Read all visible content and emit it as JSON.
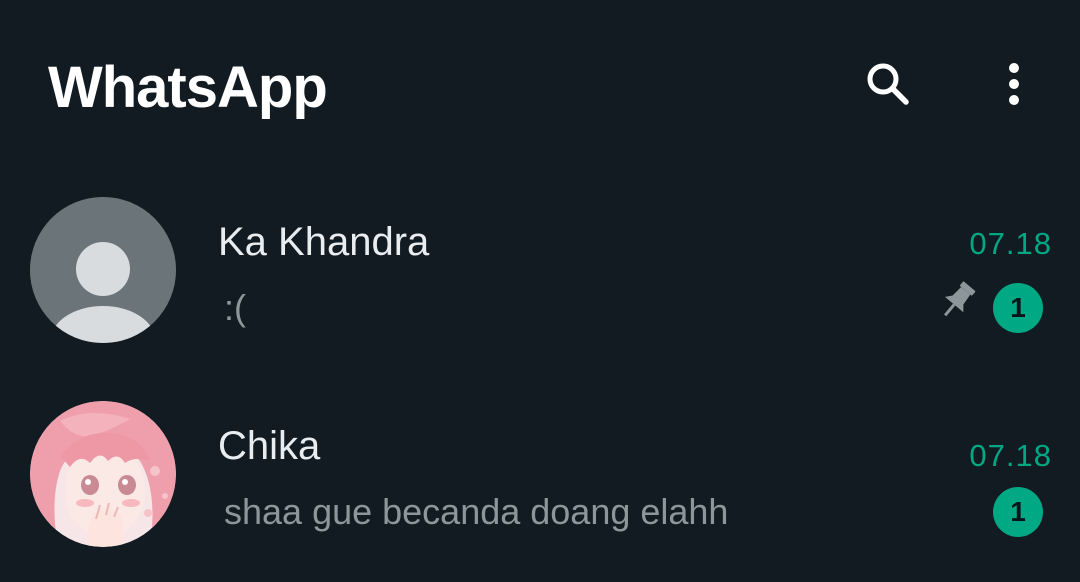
{
  "header": {
    "title": "WhatsApp",
    "search_icon": "search-icon",
    "menu_icon": "more-vertical-icon"
  },
  "chats": [
    {
      "name": "Ka Khandra",
      "last_message": ":(",
      "time": "07.18",
      "unread_count": "1",
      "pinned": true,
      "avatar": "default-person-avatar"
    },
    {
      "name": "Chika",
      "last_message": "shaa gue becanda doang elahh",
      "time": "07.18",
      "unread_count": "1",
      "pinned": false,
      "avatar": "anime-girl-pink-hair-photo"
    }
  ],
  "colors": {
    "background": "#121b22",
    "accent": "#00a884",
    "title": "#ffffff",
    "name": "#e9edef",
    "secondary_text": "#8d969b"
  }
}
